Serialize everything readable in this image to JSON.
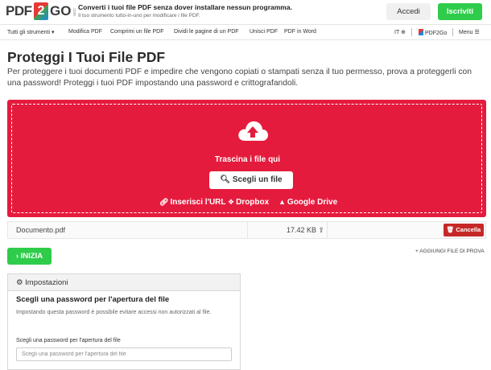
{
  "banner": {
    "logo_pdf": "PDF",
    "logo_two": "2",
    "logo_go": "GO",
    "logo_com": ".com",
    "promo_title": "Converti i tuoi file PDF senza dover installare nessun programma.",
    "promo_sub": "Il tuo strumento tutto-in-uno per modificare i file PDF.",
    "login_label": "Accedi",
    "signup_label": "Iscriviti"
  },
  "nav": {
    "items": [
      "Tutti gli strumenti ▾",
      "Modifica PDF",
      "Comprimi un file PDF",
      "Dividi le pagine di un PDF",
      "Unisci PDF",
      "PDF in Word"
    ],
    "lang": "IT",
    "brand": "PDF2Go",
    "menu": "Menu"
  },
  "page": {
    "title": "Proteggi I Tuoi File PDF",
    "description": "Per proteggere i tuoi documenti PDF e impedire che vengono copiati o stampati senza il tuo permesso, prova a proteggerli con una password! Proteggi i tuoi PDF impostando una password e crittografandoli."
  },
  "upload": {
    "drop_text": "Trascina i file qui",
    "choose_label": "Scegli un file",
    "url_label": "Inserisci l'URL",
    "dropbox_label": "Dropbox",
    "gdrive_label": "Google Drive",
    "accent_color": "#e51b3d"
  },
  "file": {
    "name": "Documento.pdf",
    "size": "17.42 KB",
    "cancel_label": "Cancella"
  },
  "actions": {
    "start_label": "INIZIA",
    "add_sample_label": "AGGIUNGI FILE DI PROVA"
  },
  "settings": {
    "header": "Impostazioni",
    "title": "Scegli una password per l'apertura del file",
    "help": "Impostando questa password è possibile evitare accessi non autorizzati al file.",
    "field_label": "Scegli una password per l'apertura del file",
    "field_placeholder": "Scegli una password per l'apertura del file",
    "field_value": ""
  }
}
